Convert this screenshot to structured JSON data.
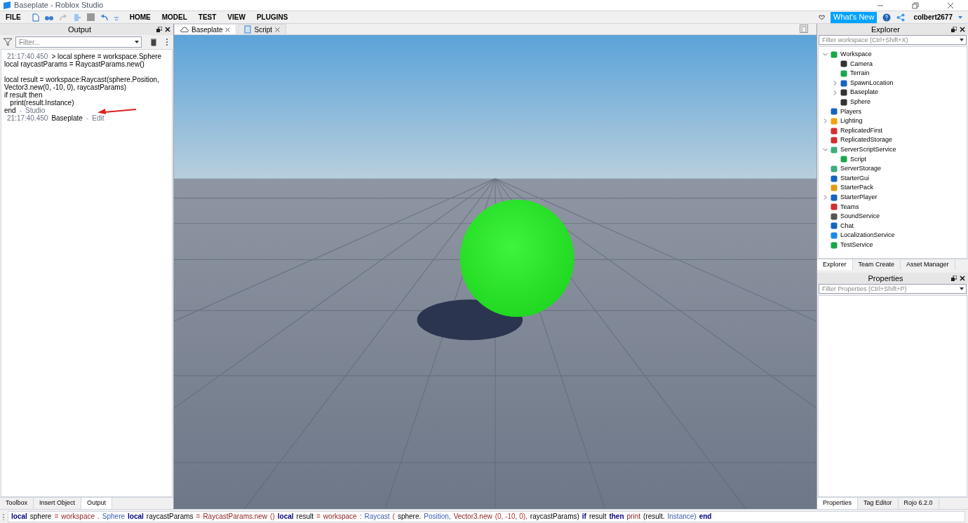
{
  "window": {
    "title": "Baseplate - Roblox Studio"
  },
  "menu": {
    "file": "FILE",
    "tabs": [
      {
        "label": "HOME",
        "selected": false
      },
      {
        "label": "MODEL",
        "selected": false
      },
      {
        "label": "TEST",
        "selected": false
      },
      {
        "label": "VIEW",
        "selected": false
      },
      {
        "label": "PLUGINS",
        "selected": false
      }
    ],
    "whats_new": "What's New",
    "user": "colbert2677"
  },
  "output": {
    "title": "Output",
    "filter": {
      "placeholder": "Filter..."
    },
    "entries": [
      {
        "time": "21:17:40.450",
        "paragraphs": [
          [
            "> local sphere = workspace.Sphere",
            "local raycastParams = RaycastParams.new()"
          ],
          [
            "local result = workspace:Raycast(sphere.Position,",
            "Vector3.new(0, -10, 0), raycastParams)",
            "if result then",
            "   print(result.Instance)",
            "end"
          ]
        ],
        "separator": "-",
        "source": "Studio"
      },
      {
        "time": "21:17:40.450",
        "paragraphs": [
          [
            "Baseplate"
          ]
        ],
        "separator": "-",
        "source": "Edit"
      }
    ],
    "tabs": [
      {
        "label": "Toolbox",
        "selected": false
      },
      {
        "label": "Insert Object",
        "selected": false
      },
      {
        "label": "Output",
        "selected": true
      }
    ]
  },
  "documents": [
    {
      "label": "Baseplate",
      "selected": true
    },
    {
      "label": "Script",
      "selected": false
    }
  ],
  "explorer": {
    "title": "Explorer",
    "filter": {
      "placeholder": "Filter workspace (Ctrl+Shift+X)"
    },
    "items": [
      {
        "label": "Workspace",
        "expanded": true,
        "children": [
          {
            "label": "Camera"
          },
          {
            "label": "Terrain"
          },
          {
            "label": "SpawnLocation",
            "expanded": false
          },
          {
            "label": "Baseplate",
            "expanded": false
          },
          {
            "label": "Sphere"
          }
        ]
      },
      {
        "label": "Players"
      },
      {
        "label": "Lighting",
        "expanded": false
      },
      {
        "label": "ReplicatedFirst"
      },
      {
        "label": "ReplicatedStorage"
      },
      {
        "label": "ServerScriptService",
        "expanded": true,
        "children": [
          {
            "label": "Script"
          }
        ]
      },
      {
        "label": "ServerStorage"
      },
      {
        "label": "StarterGui"
      },
      {
        "label": "StarterPack"
      },
      {
        "label": "StarterPlayer",
        "expanded": false
      },
      {
        "label": "Teams"
      },
      {
        "label": "SoundService"
      },
      {
        "label": "Chat"
      },
      {
        "label": "LocalizationService"
      },
      {
        "label": "TestService"
      }
    ],
    "tabs": [
      {
        "label": "Explorer",
        "selected": true
      },
      {
        "label": "Team Create",
        "selected": false
      },
      {
        "label": "Asset Manager",
        "selected": false
      }
    ]
  },
  "properties": {
    "title": "Properties",
    "filter": {
      "placeholder": "Filter Properties (Ctrl+Shift+P)"
    },
    "tabs": [
      {
        "label": "Properties",
        "selected": true
      },
      {
        "label": "Tag Editor",
        "selected": false
      },
      {
        "label": "Rojo 6.2.0",
        "selected": false
      }
    ]
  },
  "command_bar": {
    "tokens": [
      {
        "text": "local",
        "kind": "keyword"
      },
      {
        "text": "sphere",
        "kind": "ident"
      },
      {
        "text": "=",
        "kind": "op"
      },
      {
        "text": "workspace",
        "kind": "builtin"
      },
      {
        "text": ".",
        "kind": "op"
      },
      {
        "text": "Sphere",
        "kind": "prop"
      },
      {
        "text": "local",
        "kind": "keyword"
      },
      {
        "text": "raycastParams",
        "kind": "ident"
      },
      {
        "text": "=",
        "kind": "op"
      },
      {
        "text": "RaycastParams.new",
        "kind": "builtin"
      },
      {
        "text": "()",
        "kind": "op"
      },
      {
        "text": "local",
        "kind": "keyword"
      },
      {
        "text": "result",
        "kind": "ident"
      },
      {
        "text": "=",
        "kind": "op"
      },
      {
        "text": "workspace",
        "kind": "builtin"
      },
      {
        "text": ":",
        "kind": "op"
      },
      {
        "text": "Raycast",
        "kind": "prop"
      },
      {
        "text": "(",
        "kind": "op"
      },
      {
        "text": "sphere.",
        "kind": "ident"
      },
      {
        "text": "Position,",
        "kind": "prop"
      },
      {
        "text": "Vector3.new",
        "kind": "builtin"
      },
      {
        "text": "(0, -10, 0),",
        "kind": "op"
      },
      {
        "text": "raycastParams)",
        "kind": "ident"
      },
      {
        "text": "if",
        "kind": "keyword"
      },
      {
        "text": "result",
        "kind": "ident"
      },
      {
        "text": "then",
        "kind": "keyword"
      },
      {
        "text": "print",
        "kind": "builtin"
      },
      {
        "text": "(result.",
        "kind": "ident"
      },
      {
        "text": "Instance)",
        "kind": "prop"
      },
      {
        "text": "end",
        "kind": "keyword"
      }
    ]
  }
}
